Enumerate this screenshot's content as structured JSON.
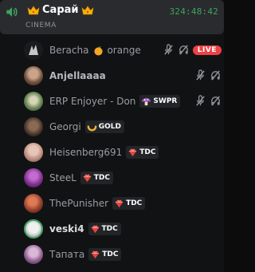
{
  "channel": {
    "name": "Сарай",
    "timer": "324:48:42",
    "category": "CINEMA"
  },
  "members": [
    {
      "name": "Beracha",
      "extra": "orange",
      "live": "LIVE"
    },
    {
      "name": "Anjellaaaa"
    },
    {
      "name": "ERP Enjoyer - Don",
      "badge": "SWPR"
    },
    {
      "name": "Georgi",
      "badge": "GOLD"
    },
    {
      "name": "Heisenberg691",
      "badge": "TDC"
    },
    {
      "name": "SteeL",
      "badge": "TDC"
    },
    {
      "name": "ThePunisher",
      "badge": "TDC"
    },
    {
      "name": "veski4",
      "badge": "TDC"
    },
    {
      "name": "Тапата",
      "badge": "TDC"
    }
  ],
  "colors": {
    "accent_green": "#3ba55c",
    "live_red": "#ed4245",
    "tdc_red": "#e5453d",
    "gold": "#f0b232",
    "swpr_purple": "#9b59b6"
  }
}
